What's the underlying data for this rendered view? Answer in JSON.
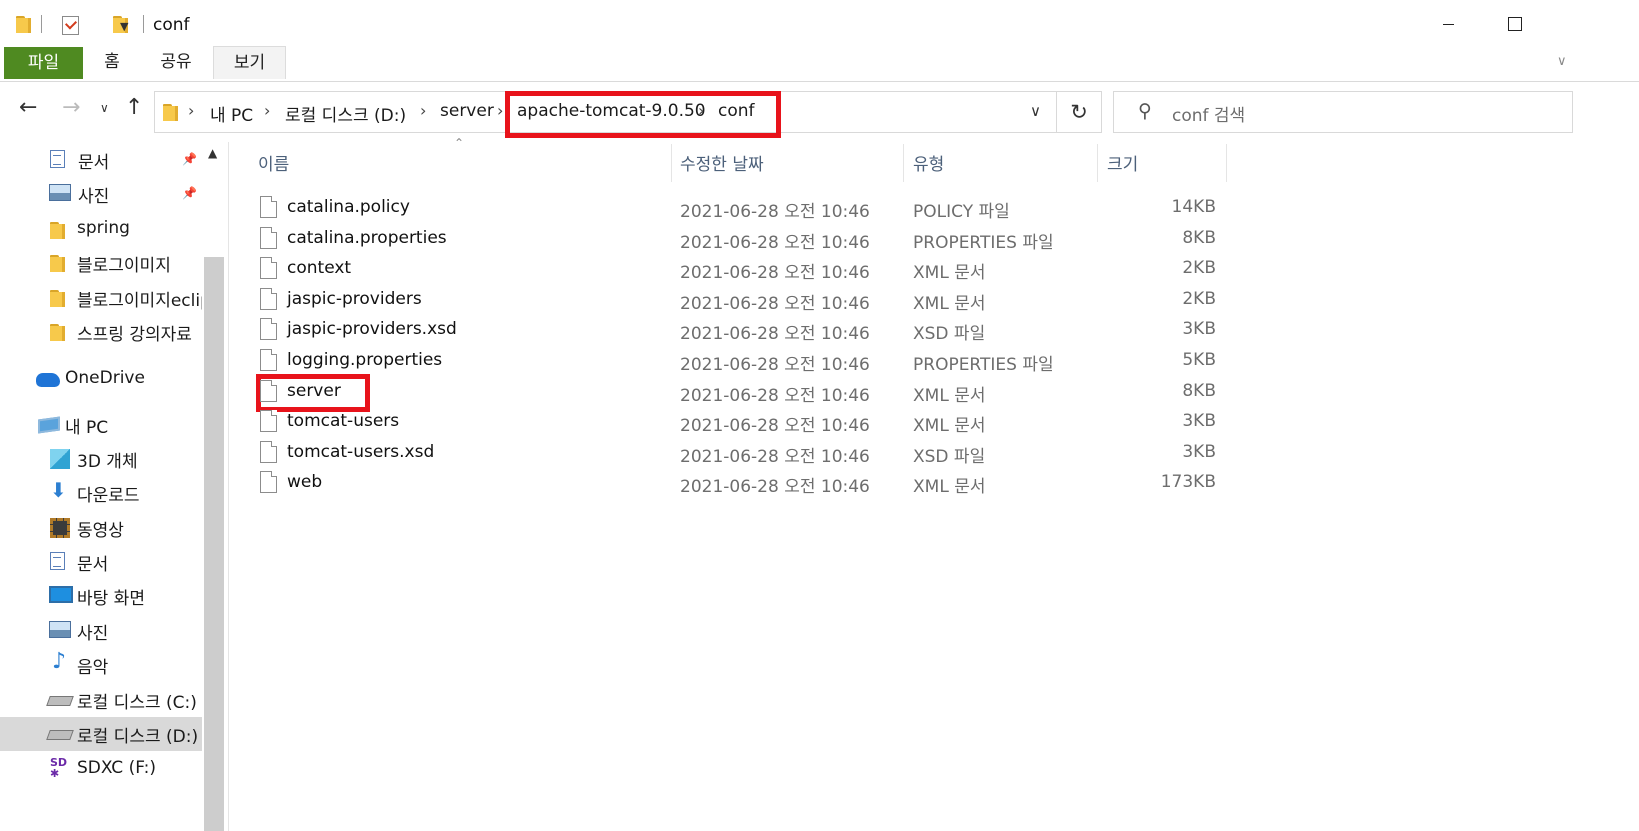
{
  "window": {
    "title": "conf"
  },
  "ribbon": {
    "tabs": [
      {
        "label": "파일"
      },
      {
        "label": "홈"
      },
      {
        "label": "공유"
      },
      {
        "label": "보기"
      }
    ]
  },
  "address": {
    "crumbs": [
      "내 PC",
      "로컬 디스크 (D:)",
      "server",
      "apache-tomcat-9.0.50",
      "conf"
    ]
  },
  "search": {
    "placeholder": "conf 검색"
  },
  "nav": {
    "items": [
      {
        "label": "문서",
        "icon": "document-icon",
        "pinned": true
      },
      {
        "label": "사진",
        "icon": "pictures-icon",
        "pinned": true
      },
      {
        "label": "spring",
        "icon": "folder-icon"
      },
      {
        "label": "블로그이미지",
        "icon": "folder-icon"
      },
      {
        "label": "블로그이미지eclipse",
        "icon": "folder-icon"
      },
      {
        "label": "스프링 강의자료",
        "icon": "folder-icon"
      },
      {
        "label": "OneDrive",
        "icon": "onedrive-cloud-icon"
      },
      {
        "label": "내 PC",
        "icon": "computer-icon"
      },
      {
        "label": "3D 개체",
        "icon": "3d-objects-icon"
      },
      {
        "label": "다운로드",
        "icon": "download-arrow-icon"
      },
      {
        "label": "동영상",
        "icon": "video-film-icon"
      },
      {
        "label": "문서",
        "icon": "document-icon"
      },
      {
        "label": "바탕 화면",
        "icon": "desktop-icon"
      },
      {
        "label": "사진",
        "icon": "pictures-icon"
      },
      {
        "label": "음악",
        "icon": "music-note-icon"
      },
      {
        "label": "로컬 디스크 (C:)",
        "icon": "windows-drive-icon"
      },
      {
        "label": "로컬 디스크 (D:)",
        "icon": "drive-icon",
        "selected": true
      },
      {
        "label": "SDXC (F:)",
        "icon": "sd-card-icon"
      }
    ]
  },
  "columns": {
    "name": "이름",
    "date": "수정한 날짜",
    "type": "유형",
    "size": "크기"
  },
  "files": [
    {
      "name": "catalina.policy",
      "date": "2021-06-28 오전 10:46",
      "type": "POLICY 파일",
      "size": "14KB"
    },
    {
      "name": "catalina.properties",
      "date": "2021-06-28 오전 10:46",
      "type": "PROPERTIES 파일",
      "size": "8KB"
    },
    {
      "name": "context",
      "date": "2021-06-28 오전 10:46",
      "type": "XML 문서",
      "size": "2KB"
    },
    {
      "name": "jaspic-providers",
      "date": "2021-06-28 오전 10:46",
      "type": "XML 문서",
      "size": "2KB"
    },
    {
      "name": "jaspic-providers.xsd",
      "date": "2021-06-28 오전 10:46",
      "type": "XSD 파일",
      "size": "3KB"
    },
    {
      "name": "logging.properties",
      "date": "2021-06-28 오전 10:46",
      "type": "PROPERTIES 파일",
      "size": "5KB"
    },
    {
      "name": "server",
      "date": "2021-06-28 오전 10:46",
      "type": "XML 문서",
      "size": "8KB"
    },
    {
      "name": "tomcat-users",
      "date": "2021-06-28 오전 10:46",
      "type": "XML 문서",
      "size": "3KB"
    },
    {
      "name": "tomcat-users.xsd",
      "date": "2021-06-28 오전 10:46",
      "type": "XSD 파일",
      "size": "3KB"
    },
    {
      "name": "web",
      "date": "2021-06-28 오전 10:46",
      "type": "XML 문서",
      "size": "173KB"
    }
  ],
  "colors": {
    "file_tab": "#4f8a21",
    "highlight_box": "#e8131b",
    "selected_nav": "#d9d9d9"
  }
}
